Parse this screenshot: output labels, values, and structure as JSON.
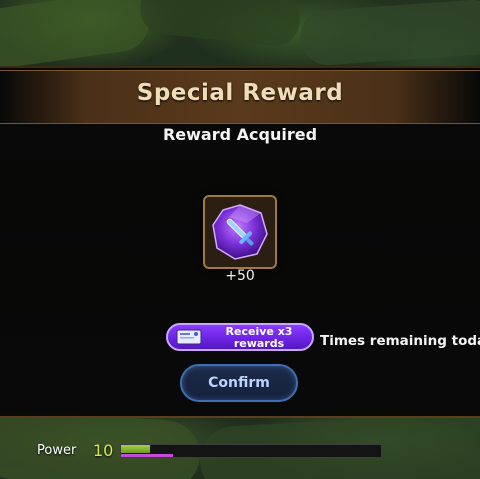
{
  "dialog": {
    "title": "Special Reward",
    "subtitle": "Reward Acquired"
  },
  "reward": {
    "icon": "sword-gem-icon",
    "amount": "+50"
  },
  "receive_button": {
    "label": "Receive x3 rewards",
    "icon": "ticket-icon"
  },
  "times_remaining": "Times remaining today：",
  "confirm_button": {
    "label": "Confirm"
  },
  "power": {
    "label": "Power",
    "value": "10",
    "progress_green": 0.11,
    "progress_purple": 0.2
  },
  "colors": {
    "title": "#f1dcb8",
    "accent_purple": "#6a22e0",
    "confirm_border": "#3f6fb3",
    "power_green": "#a4d24a",
    "power_purple": "#c44bd8"
  }
}
